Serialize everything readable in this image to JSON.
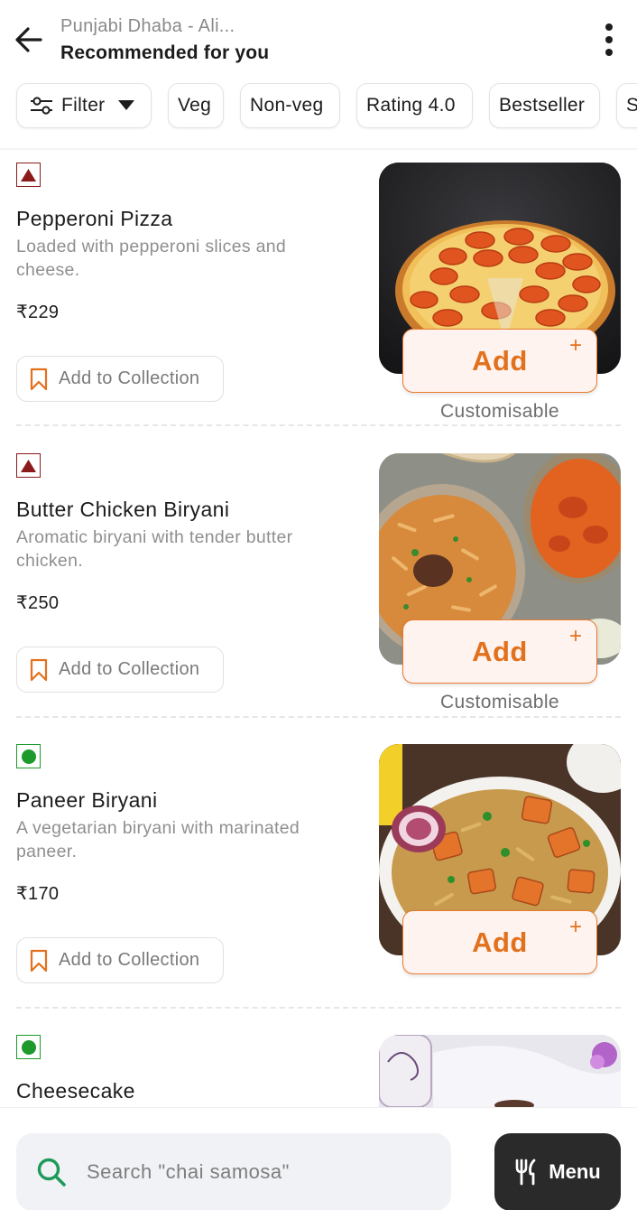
{
  "header": {
    "restaurant": "Punjabi Dhaba - Ali...",
    "title": "Recommended for you",
    "back_icon": "arrow-left-icon",
    "more_icon": "more-vertical-icon"
  },
  "filters": [
    {
      "label": "Filter"
    },
    {
      "label": "Veg"
    },
    {
      "label": "Non-veg"
    },
    {
      "label": "Rating 4.0"
    },
    {
      "label": "Bestseller"
    },
    {
      "label": "S"
    }
  ],
  "colors": {
    "accent": "#e2711d",
    "nonveg": "#8b1a1a",
    "veg": "#1d9a2b",
    "dark_button": "#2a2a2a"
  },
  "items": [
    {
      "type": "nonveg",
      "name": "Pepperoni Pizza",
      "description": "Loaded with pepperoni slices and cheese.",
      "price": "₹229",
      "collection_label": "Add to Collection",
      "add_label": "Add",
      "add_plus": "+",
      "note": "Customisable"
    },
    {
      "type": "nonveg",
      "name": "Butter Chicken Biryani",
      "description": "Aromatic biryani with tender butter chicken.",
      "price": "₹250",
      "collection_label": "Add to Collection",
      "add_label": "Add",
      "add_plus": "+",
      "note": "Customisable"
    },
    {
      "type": "veg",
      "name": "Paneer Biryani",
      "description": "A vegetarian biryani with marinated paneer.",
      "price": "₹170",
      "collection_label": "Add to Collection",
      "add_label": "Add",
      "add_plus": "+"
    },
    {
      "type": "veg",
      "name": "Cheesecake"
    }
  ],
  "bottom": {
    "search_placeholder": "Search \"chai samosa\"",
    "menu_label": "Menu"
  }
}
